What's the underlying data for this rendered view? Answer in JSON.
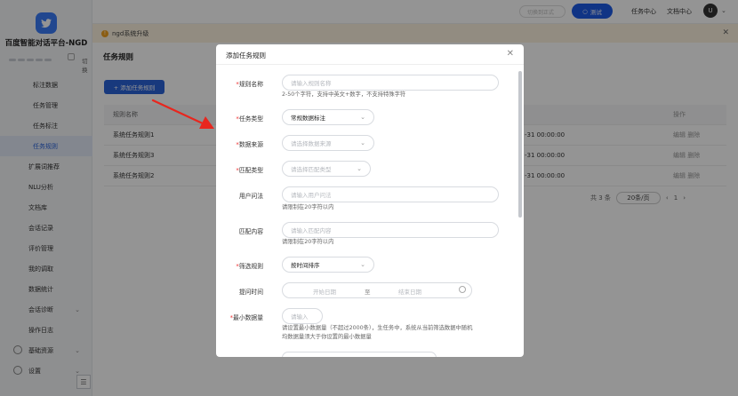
{
  "sidebar": {
    "brand": "百度智能对话平台-NGD",
    "switch_label": "切换",
    "items": [
      {
        "label": "标注数据",
        "kind": "sub"
      },
      {
        "label": "任务管理",
        "kind": "sub"
      },
      {
        "label": "任务标注",
        "kind": "sub"
      },
      {
        "label": "任务规则",
        "kind": "sub",
        "active": true
      },
      {
        "label": "扩展词推荐",
        "kind": "top"
      },
      {
        "label": "NLU分析",
        "kind": "top"
      },
      {
        "label": "文档库",
        "kind": "top"
      },
      {
        "label": "会话记录",
        "kind": "top"
      },
      {
        "label": "评价管理",
        "kind": "top"
      },
      {
        "label": "我的调取",
        "kind": "top"
      },
      {
        "label": "数据统计",
        "kind": "top"
      },
      {
        "label": "会话诊断",
        "kind": "top",
        "chevron": true
      },
      {
        "label": "操作日志",
        "kind": "top"
      },
      {
        "label": "基础资源",
        "kind": "top",
        "chevron": true
      },
      {
        "label": "设置",
        "kind": "top",
        "chevron": true
      }
    ]
  },
  "header": {
    "search_placeholder": "切换到正式",
    "test_button": "测试",
    "links": [
      "任务中心",
      "文档中心"
    ],
    "avatar_letter": "U"
  },
  "notice": {
    "text": "ngd系统升级"
  },
  "page": {
    "title": "任务规则",
    "add_button": "+ 添加任务规则",
    "table": {
      "headers": [
        "规则名称",
        "操作"
      ],
      "rows": [
        {
          "name": "系统任务规则1",
          "time": "-31 00:00:00",
          "ops": "编辑  删除"
        },
        {
          "name": "系统任务规则3",
          "time": "-31 00:00:00",
          "ops": "编辑  删除"
        },
        {
          "name": "系统任务规则2",
          "time": "-31 00:00:00",
          "ops": "编辑  删除"
        }
      ]
    },
    "pagination": {
      "total": "共 3 条",
      "page_size": "20条/页",
      "current": "1"
    }
  },
  "modal": {
    "title": "添加任务规则",
    "fields": {
      "rule_name": {
        "label": "规则名称",
        "placeholder": "请输入规则名称",
        "hint": "2-50个字符，支持中英文+数字，不支持特殊字符"
      },
      "task_type": {
        "label": "任务类型",
        "value": "常规数据标注"
      },
      "data_source": {
        "label": "数据来源",
        "placeholder": "请选择数据来源"
      },
      "match_type": {
        "label": "匹配类型",
        "placeholder": "请选择匹配类型"
      },
      "user_query": {
        "label": "用户问法",
        "placeholder": "请输入用户问法",
        "hint": "请限制在20字符以内"
      },
      "match_content": {
        "label": "匹配内容",
        "placeholder": "请输入匹配内容",
        "hint": "请限制在20字符以内"
      },
      "filter_rule": {
        "label": "筛选规则",
        "value": "按时间排序"
      },
      "time_range": {
        "label": "提问时间",
        "start_placeholder": "开始日期",
        "separator": "至",
        "end_placeholder": "结束日期"
      },
      "min_count": {
        "label": "最小数据量",
        "placeholder": "请输入",
        "hint_line1": "请设置最小数据量（不超过2000条），生任务中，系统从当前筛选数据中随机",
        "hint_line2": "均数据量须大于你设置的最小数据量"
      }
    }
  }
}
